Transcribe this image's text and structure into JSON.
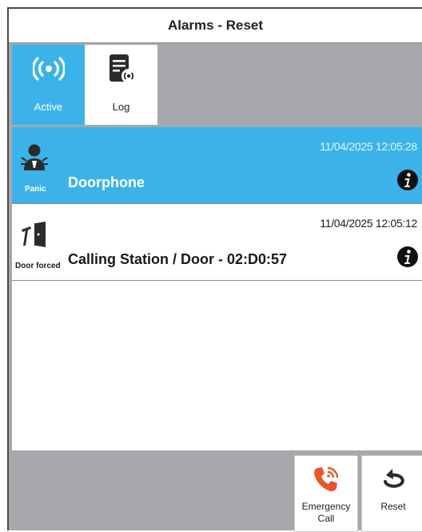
{
  "window": {
    "title": "Alarms - Reset"
  },
  "tabs": [
    {
      "label": "Active",
      "icon": "broadcast-icon",
      "selected": true
    },
    {
      "label": "Log",
      "icon": "log-document-icon",
      "selected": false
    }
  ],
  "alarms": [
    {
      "type_label": "Panic",
      "icon": "panic-person-icon",
      "description": "Doorphone",
      "timestamp": "11/04/2025 12:05:28",
      "selected": true
    },
    {
      "type_label": "Door forced",
      "icon": "door-forced-icon",
      "description": "Calling Station / Door - 02:D0:57",
      "timestamp": "11/04/2025 12:05:12",
      "selected": false
    }
  ],
  "actions": {
    "emergency_label": "Emergency\nCall",
    "reset_label": "Reset"
  },
  "colors": {
    "accent": "#3bb3ea",
    "frame": "#a6a8ab",
    "emergency_icon": "#e8552b",
    "text": "#1a1a1a"
  }
}
